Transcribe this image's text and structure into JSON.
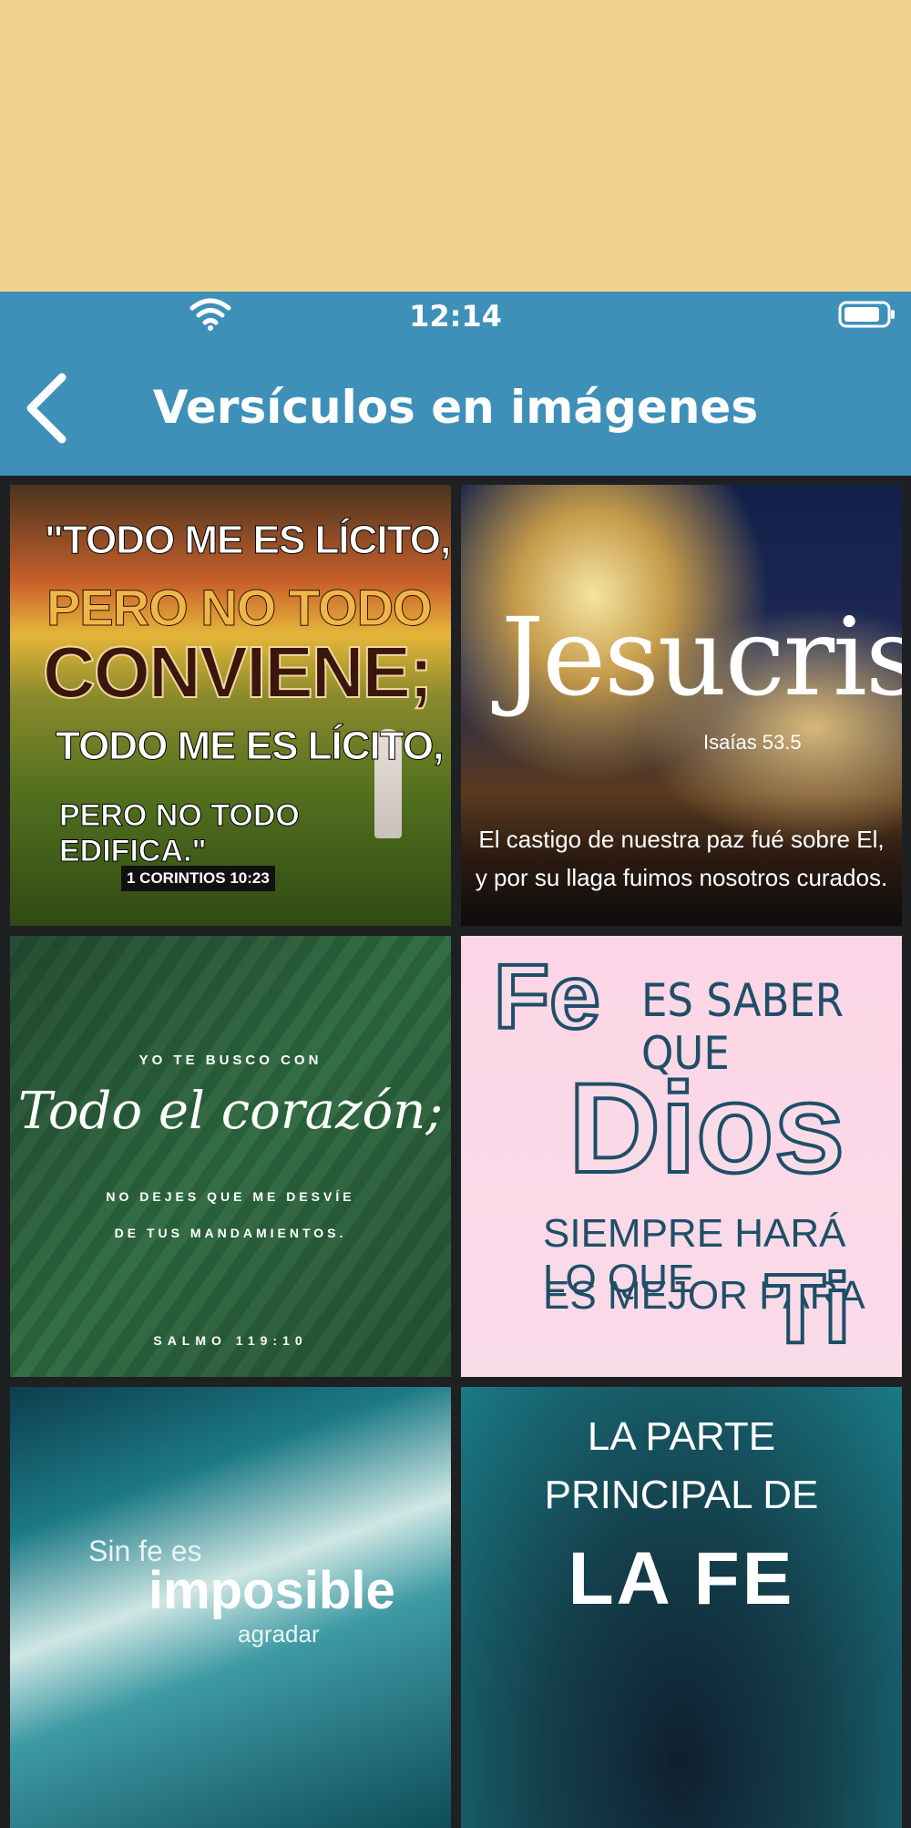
{
  "status_bar": {
    "time": "12:14"
  },
  "nav": {
    "title": "Versículos en imágenes",
    "back_icon": "chevron-left-icon"
  },
  "images": [
    {
      "lines": [
        "\"TODO ME ES LÍCITO,",
        "PERO NO TODO",
        "CONVIENE;",
        "TODO ME ES LÍCITO,",
        "PERO NO TODO EDIFICA.\""
      ],
      "reference": "1 CORINTIOS 10:23"
    },
    {
      "title": "Jesucristo",
      "reference": "Isaías 53.5",
      "lines": [
        "El castigo de nuestra paz fué sobre El,",
        "y por su llaga fuimos nosotros curados."
      ]
    },
    {
      "lines": [
        "YO TE BUSCO CON",
        "Todo el corazón;",
        "NO DEJES QUE ME DESVÍE",
        "DE TUS MANDAMIENTOS."
      ],
      "reference": "SALMO 119:10"
    },
    {
      "lines": [
        "Fe",
        "ES SABER QUE",
        "Dios",
        "SIEMPRE HARÁ LO QUE",
        "ES MEJOR PARA",
        "Ti"
      ]
    },
    {
      "lines": [
        "Sin fe es",
        "imposible",
        "agradar"
      ]
    },
    {
      "lines": [
        "LA PARTE",
        "PRINCIPAL DE",
        "LA FE"
      ]
    }
  ]
}
